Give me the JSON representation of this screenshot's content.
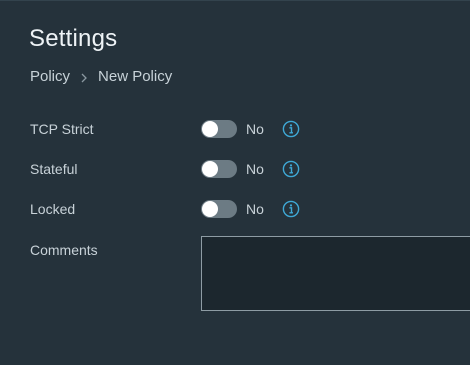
{
  "page": {
    "title": "Settings"
  },
  "breadcrumb": {
    "parent": "Policy",
    "current": "New Policy"
  },
  "settings": [
    {
      "label": "TCP Strict",
      "value": "No"
    },
    {
      "label": "Stateful",
      "value": "No"
    },
    {
      "label": "Locked",
      "value": "No"
    }
  ],
  "comments": {
    "label": "Comments",
    "value": ""
  },
  "icons": {
    "breadcrumb_separator": "chevron-right-icon",
    "info": "info-icon"
  },
  "colors": {
    "background": "#25323b",
    "info_accent": "#3fa9d6",
    "toggle_off": "#6c7b84"
  }
}
